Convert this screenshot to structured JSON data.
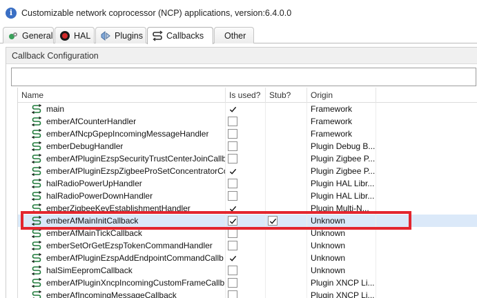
{
  "window": {
    "title": "Customizable network coprocessor (NCP) applications, version:6.4.0.0",
    "title_icon": "info-icon"
  },
  "tabs": [
    {
      "label": "General",
      "icon": "general-icon"
    },
    {
      "label": "HAL",
      "icon": "hal-icon"
    },
    {
      "label": "Plugins",
      "icon": "plugins-icon"
    },
    {
      "label": "Callbacks",
      "icon": "callbacks-icon",
      "active": true
    },
    {
      "label": "Other",
      "icon": ""
    }
  ],
  "panel": {
    "title": "Callback Configuration"
  },
  "filter": {
    "value": "",
    "placeholder": ""
  },
  "table": {
    "columns": {
      "name": "Name",
      "used": "Is used?",
      "stub": "Stub?",
      "origin": "Origin"
    },
    "rows": [
      {
        "name": "main",
        "used": true,
        "used_box": false,
        "stub": false,
        "stub_box": false,
        "origin": "Framework"
      },
      {
        "name": "emberAfCounterHandler",
        "used": false,
        "used_box": true,
        "stub": false,
        "origin": "Framework"
      },
      {
        "name": "emberAfNcpGpepIncomingMessageHandler",
        "used": false,
        "used_box": true,
        "stub": false,
        "origin": "Framework"
      },
      {
        "name": "emberDebugHandler",
        "used": false,
        "used_box": true,
        "stub": false,
        "origin": "Plugin Debug B..."
      },
      {
        "name": "emberAfPluginEzspSecurityTrustCenterJoinCallba",
        "used": false,
        "used_box": true,
        "stub": false,
        "origin": "Plugin Zigbee P..."
      },
      {
        "name": "emberAfPluginEzspZigbeeProSetConcentratorCo",
        "used": true,
        "used_box": false,
        "stub": false,
        "origin": "Plugin Zigbee P..."
      },
      {
        "name": "halRadioPowerUpHandler",
        "used": false,
        "used_box": true,
        "stub": false,
        "origin": "Plugin HAL Libr..."
      },
      {
        "name": "halRadioPowerDownHandler",
        "used": false,
        "used_box": true,
        "stub": false,
        "origin": "Plugin HAL Libr..."
      },
      {
        "name": "emberZigbeeKeyEstablishmentHandler",
        "used": true,
        "used_box": false,
        "stub": false,
        "origin": "Plugin Multi-N..."
      },
      {
        "name": "emberAfMainInitCallback",
        "used": true,
        "used_box": true,
        "stub": true,
        "stub_box": true,
        "origin": "Unknown",
        "selected": true
      },
      {
        "name": "emberAfMainTickCallback",
        "used": false,
        "used_box": true,
        "stub": false,
        "origin": "Unknown"
      },
      {
        "name": "emberSetOrGetEzspTokenCommandHandler",
        "used": false,
        "used_box": true,
        "stub": false,
        "origin": "Unknown"
      },
      {
        "name": "emberAfPluginEzspAddEndpointCommandCallb",
        "used": true,
        "used_box": false,
        "stub": false,
        "origin": "Unknown"
      },
      {
        "name": "halSimEepromCallback",
        "used": false,
        "used_box": true,
        "stub": false,
        "origin": "Unknown"
      },
      {
        "name": "emberAfPluginXncpIncomingCustomFrameCallb",
        "used": false,
        "used_box": true,
        "stub": false,
        "origin": "Plugin XNCP Li..."
      },
      {
        "name": "emberAfIncomingMessageCallback",
        "used": false,
        "used_box": true,
        "stub": false,
        "origin": "Plugin XNCP Li..."
      }
    ]
  },
  "colors": {
    "highlight": "#e3262e",
    "selection": "#dbe9f9",
    "callback_icon": "#1f7a3a"
  }
}
